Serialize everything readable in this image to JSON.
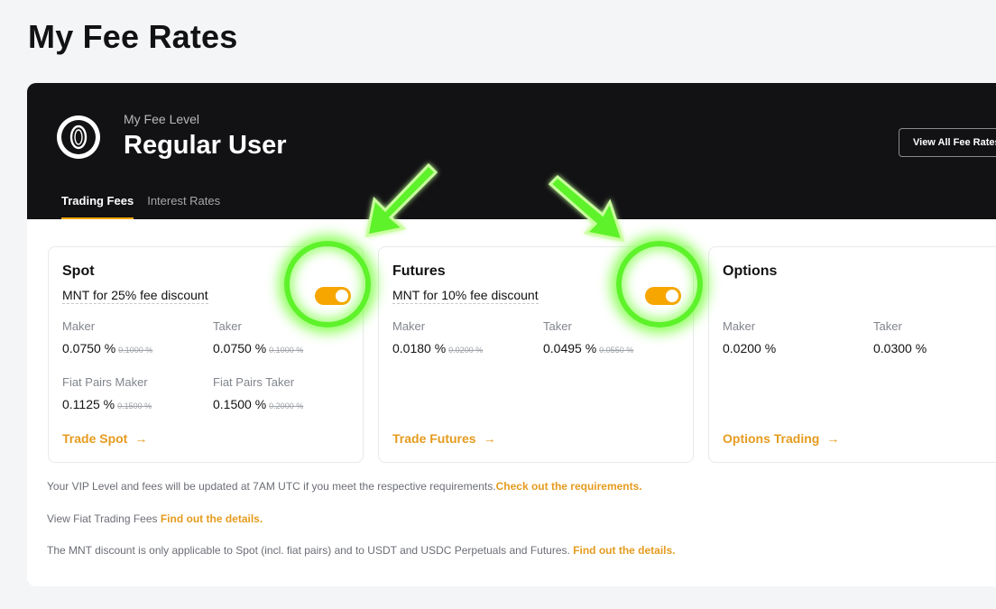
{
  "page_title": "My Fee Rates",
  "fee_level": {
    "label": "My Fee Level",
    "name": "Regular User",
    "badge_char": "0"
  },
  "header": {
    "view_all_label": "View All Fee Rates"
  },
  "tabs": [
    {
      "label": "Trading Fees",
      "active": true
    },
    {
      "label": "Interest Rates",
      "active": false
    }
  ],
  "cards": {
    "spot": {
      "title": "Spot",
      "discount": "MNT for 25% fee discount",
      "toggle_on": true,
      "maker_label": "Maker",
      "maker_value": "0.0750 %",
      "maker_old": "0.1000 %",
      "taker_label": "Taker",
      "taker_value": "0.0750 %",
      "taker_old": "0.1000 %",
      "fiat_maker_label": "Fiat Pairs Maker",
      "fiat_maker_value": "0.1125 %",
      "fiat_maker_old": "0.1500 %",
      "fiat_taker_label": "Fiat Pairs Taker",
      "fiat_taker_value": "0.1500 %",
      "fiat_taker_old": "0.2000 %",
      "link": "Trade Spot"
    },
    "futures": {
      "title": "Futures",
      "discount": "MNT for 10% fee discount",
      "toggle_on": true,
      "maker_label": "Maker",
      "maker_value": "0.0180 %",
      "maker_old": "0.0200 %",
      "taker_label": "Taker",
      "taker_value": "0.0495 %",
      "taker_old": "0.0550 %",
      "link": "Trade Futures"
    },
    "options": {
      "title": "Options",
      "maker_label": "Maker",
      "maker_value": "0.0200 %",
      "taker_label": "Taker",
      "taker_value": "0.0300 %",
      "link": "Options Trading"
    }
  },
  "notes": {
    "vip_text": "Your VIP Level and fees will be updated at 7AM UTC if you meet the respective requirements.",
    "vip_link": "Check out the requirements.",
    "fiat_text": "View Fiat Trading Fees ",
    "fiat_link": "Find out the details.",
    "mnt_text": "The MNT discount is only applicable to Spot (incl. fiat pairs) and to USDT and USDC Perpetuals and Futures. ",
    "mnt_link": "Find out the details."
  },
  "colors": {
    "accent": "#f7a600",
    "link": "#e59b1e",
    "header_bg": "#121214",
    "annotation_glow": "#5df22a"
  },
  "icons": {
    "arrow": "arrow-right-icon",
    "annotation": "annotation-arrow-icon"
  }
}
